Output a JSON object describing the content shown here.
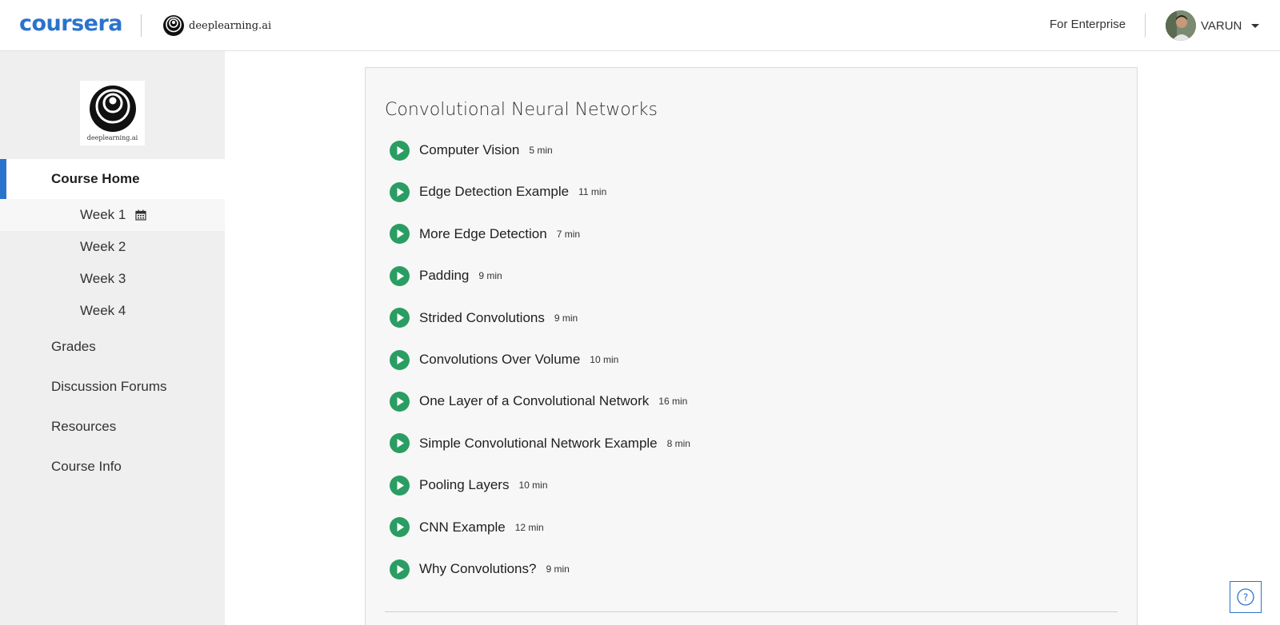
{
  "header": {
    "brand": "coursera",
    "partner": "deeplearning.ai",
    "enterprise_link": "For Enterprise",
    "username": "VARUN"
  },
  "sidebar": {
    "logo_text": "deeplearning.ai",
    "course_home": "Course Home",
    "weeks": [
      "Week 1",
      "Week 2",
      "Week 3",
      "Week 4"
    ],
    "items": [
      "Grades",
      "Discussion Forums",
      "Resources",
      "Course Info"
    ]
  },
  "main": {
    "section_title": "Convolutional Neural Networks",
    "lessons": [
      {
        "title": "Computer Vision",
        "duration": "5 min"
      },
      {
        "title": "Edge Detection Example",
        "duration": "11 min"
      },
      {
        "title": "More Edge Detection",
        "duration": "7 min"
      },
      {
        "title": "Padding",
        "duration": "9 min"
      },
      {
        "title": "Strided Convolutions",
        "duration": "9 min"
      },
      {
        "title": "Convolutions Over Volume",
        "duration": "10 min"
      },
      {
        "title": "One Layer of a Convolutional Network",
        "duration": "16 min"
      },
      {
        "title": "Simple Convolutional Network Example",
        "duration": "8 min"
      },
      {
        "title": "Pooling Layers",
        "duration": "10 min"
      },
      {
        "title": "CNN Example",
        "duration": "12 min"
      },
      {
        "title": "Why Convolutions?",
        "duration": "9 min"
      }
    ]
  },
  "colors": {
    "brand_blue": "#2a73cc",
    "play_green": "#2a9d63"
  },
  "icons": {
    "help": "question-circle-icon",
    "calendar": "calendar-icon",
    "play": "play-circle-icon"
  }
}
